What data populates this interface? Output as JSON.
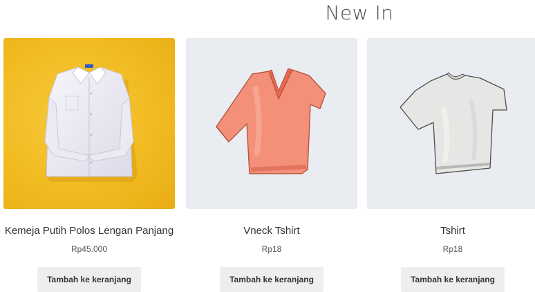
{
  "section": {
    "title": "New In"
  },
  "products": [
    {
      "name": "Kemeja Putih Polos Lengan Panjang",
      "price": "Rp45.000",
      "button_label": "Tambah ke keranjang",
      "image_icon": "white-long-sleeve-shirt-icon",
      "image_background": "#f2bb22"
    },
    {
      "name": "Vneck Tshirt",
      "price": "Rp18",
      "button_label": "Tambah ke keranjang",
      "image_icon": "coral-vneck-tshirt-icon",
      "image_background": "#e9edf1"
    },
    {
      "name": "Tshirt",
      "price": "Rp18",
      "button_label": "Tambah ke keranjang",
      "image_icon": "grey-tshirt-icon",
      "image_background": "#e9edf1"
    }
  ],
  "colors": {
    "button_bg": "#eeeeee",
    "vneck_shirt": "#f4907a",
    "plain_shirt": "#e6e6e4"
  }
}
